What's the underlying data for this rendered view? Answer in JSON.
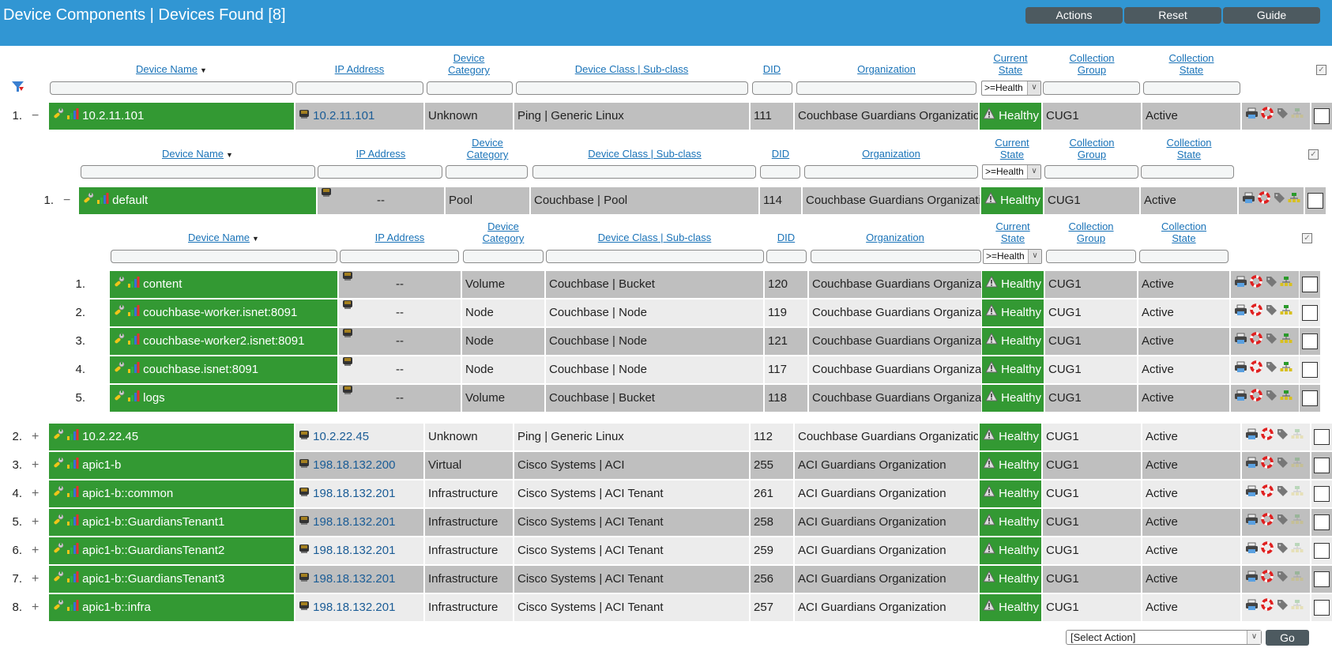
{
  "header": {
    "title": "Device Components | Devices Found [8]",
    "buttons": [
      "Actions",
      "Reset",
      "Guide"
    ]
  },
  "columns": {
    "device_name": "Device Name",
    "ip_address": "IP Address",
    "device_category_1": "Device",
    "device_category_2": "Category",
    "device_class": "Device Class | Sub-class",
    "did": "DID",
    "organization": "Organization",
    "current_state_1": "Current",
    "current_state_2": "State",
    "collection_group_1": "Collection",
    "collection_group_2": "Group",
    "collection_state_1": "Collection",
    "collection_state_2": "State"
  },
  "filters": {
    "state_filter_value": ">=Health"
  },
  "level1": [
    {
      "num": "1.",
      "toggle": "−",
      "name": "10.2.11.101",
      "ip": "10.2.11.101",
      "category": "Unknown",
      "class": "Ping | Generic Linux",
      "did": "111",
      "org": "Couchbase Guardians Organization",
      "state": "Healthy",
      "group": "CUG1",
      "cstate": "Active",
      "tree_icon_active": false
    },
    {
      "num": "2.",
      "toggle": "+",
      "name": "10.2.22.45",
      "ip": "10.2.22.45",
      "category": "Unknown",
      "class": "Ping | Generic Linux",
      "did": "112",
      "org": "Couchbase Guardians Organization",
      "state": "Healthy",
      "group": "CUG1",
      "cstate": "Active",
      "tree_icon_active": false
    },
    {
      "num": "3.",
      "toggle": "+",
      "name": "apic1-b",
      "ip": "198.18.132.200",
      "category": "Virtual",
      "class": "Cisco Systems | ACI",
      "did": "255",
      "org": "ACI Guardians Organization",
      "state": "Healthy",
      "group": "CUG1",
      "cstate": "Active",
      "tree_icon_active": false
    },
    {
      "num": "4.",
      "toggle": "+",
      "name": "apic1-b::common",
      "ip": "198.18.132.201",
      "category": "Infrastructure",
      "class": "Cisco Systems | ACI Tenant",
      "did": "261",
      "org": "ACI Guardians Organization",
      "state": "Healthy",
      "group": "CUG1",
      "cstate": "Active",
      "tree_icon_active": false
    },
    {
      "num": "5.",
      "toggle": "+",
      "name": "apic1-b::GuardiansTenant1",
      "ip": "198.18.132.201",
      "category": "Infrastructure",
      "class": "Cisco Systems | ACI Tenant",
      "did": "258",
      "org": "ACI Guardians Organization",
      "state": "Healthy",
      "group": "CUG1",
      "cstate": "Active",
      "tree_icon_active": false
    },
    {
      "num": "6.",
      "toggle": "+",
      "name": "apic1-b::GuardiansTenant2",
      "ip": "198.18.132.201",
      "category": "Infrastructure",
      "class": "Cisco Systems | ACI Tenant",
      "did": "259",
      "org": "ACI Guardians Organization",
      "state": "Healthy",
      "group": "CUG1",
      "cstate": "Active",
      "tree_icon_active": false
    },
    {
      "num": "7.",
      "toggle": "+",
      "name": "apic1-b::GuardiansTenant3",
      "ip": "198.18.132.201",
      "category": "Infrastructure",
      "class": "Cisco Systems | ACI Tenant",
      "did": "256",
      "org": "ACI Guardians Organization",
      "state": "Healthy",
      "group": "CUG1",
      "cstate": "Active",
      "tree_icon_active": false
    },
    {
      "num": "8.",
      "toggle": "+",
      "name": "apic1-b::infra",
      "ip": "198.18.132.201",
      "category": "Infrastructure",
      "class": "Cisco Systems | ACI Tenant",
      "did": "257",
      "org": "ACI Guardians Organization",
      "state": "Healthy",
      "group": "CUG1",
      "cstate": "Active",
      "tree_icon_active": false
    }
  ],
  "level2": [
    {
      "num": "1.",
      "toggle": "−",
      "name": "default",
      "ip": "--",
      "category": "Pool",
      "class": "Couchbase | Pool",
      "did": "114",
      "org": "Couchbase Guardians Organization",
      "state": "Healthy",
      "group": "CUG1",
      "cstate": "Active",
      "tree_icon_active": true
    }
  ],
  "level3": [
    {
      "num": "1.",
      "name": "content",
      "ip": "--",
      "category": "Volume",
      "class": "Couchbase | Bucket",
      "did": "120",
      "org": "Couchbase Guardians Organization",
      "state": "Healthy",
      "group": "CUG1",
      "cstate": "Active",
      "tree_icon_active": true
    },
    {
      "num": "2.",
      "name": "couchbase-worker.isnet:8091",
      "ip": "--",
      "category": "Node",
      "class": "Couchbase | Node",
      "did": "119",
      "org": "Couchbase Guardians Organization",
      "state": "Healthy",
      "group": "CUG1",
      "cstate": "Active",
      "tree_icon_active": true
    },
    {
      "num": "3.",
      "name": "couchbase-worker2.isnet:8091",
      "ip": "--",
      "category": "Node",
      "class": "Couchbase | Node",
      "did": "121",
      "org": "Couchbase Guardians Organization",
      "state": "Healthy",
      "group": "CUG1",
      "cstate": "Active",
      "tree_icon_active": true
    },
    {
      "num": "4.",
      "name": "couchbase.isnet:8091",
      "ip": "--",
      "category": "Node",
      "class": "Couchbase | Node",
      "did": "117",
      "org": "Couchbase Guardians Organization",
      "state": "Healthy",
      "group": "CUG1",
      "cstate": "Active",
      "tree_icon_active": true
    },
    {
      "num": "5.",
      "name": "logs",
      "ip": "--",
      "category": "Volume",
      "class": "Couchbase | Bucket",
      "did": "118",
      "org": "Couchbase Guardians Organization",
      "state": "Healthy",
      "group": "CUG1",
      "cstate": "Active",
      "tree_icon_active": true
    }
  ],
  "footer": {
    "action_select": "[Select Action]",
    "go_label": "Go"
  },
  "colors": {
    "header_bg": "#3196d3",
    "healthy_green": "#339933",
    "row_dark": "#bfbfbf",
    "row_light": "#ececec",
    "link_blue": "#1a73b8"
  }
}
